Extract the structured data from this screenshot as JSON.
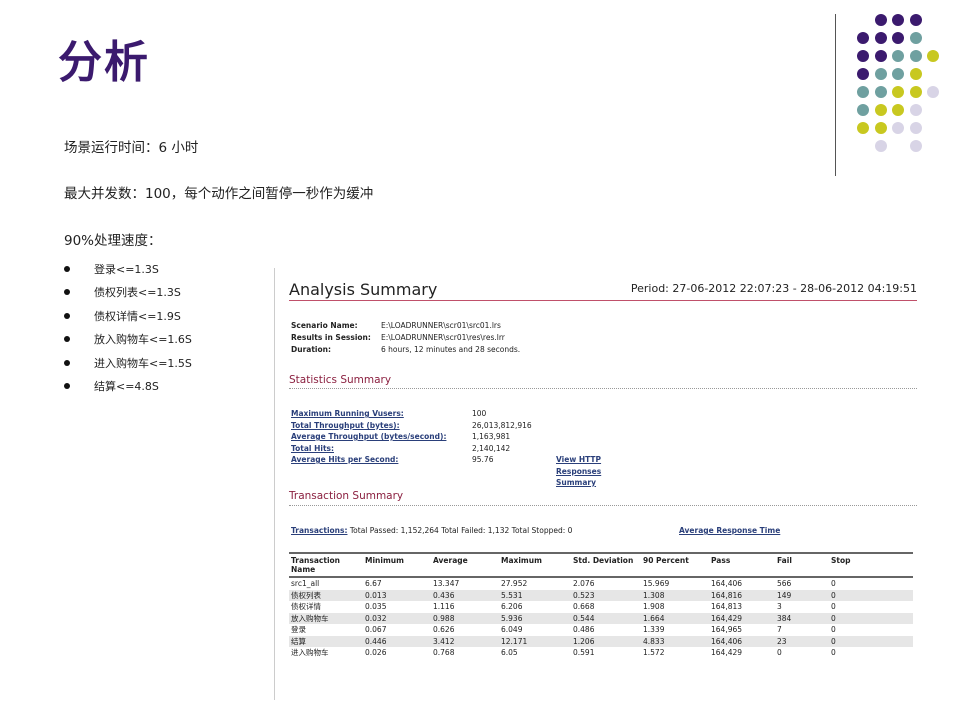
{
  "slide": {
    "title": "分析",
    "line1": "场景运行时间：6 小时",
    "line2": "最大并发数：100，每个动作之间暂停一秒作为缓冲",
    "line3": "90%处理速度：",
    "bullets": [
      "登录<=1.3S",
      "债权列表<=1.3S",
      "债权详情<=1.9S",
      "放入购物车<=1.6S",
      "进入购物车<=1.5S",
      "结算<=4.8S"
    ]
  },
  "decor": {
    "colors": {
      "purple": "#3b1a6e",
      "teal": "#6fa0a0",
      "lime": "#c8c820",
      "lavender": "#d8d4e6"
    }
  },
  "report": {
    "title": "Analysis Summary",
    "period": "Period: 27-06-2012 22:07:23 - 28-06-2012 04:19:51",
    "scenario": [
      {
        "key": "Scenario Name:",
        "value": "E:\\LOADRUNNER\\scr01\\src01.lrs"
      },
      {
        "key": "Results in Session:",
        "value": "E:\\LOADRUNNER\\scr01\\res\\res.lrr"
      },
      {
        "key": "Duration:",
        "value": "6 hours, 12 minutes and 28 seconds."
      }
    ],
    "stats_title": "Statistics Summary",
    "stats": [
      {
        "label": "Maximum Running Vusers:",
        "value": "100"
      },
      {
        "label": "Total Throughput (bytes):",
        "value": "26,013,812,916"
      },
      {
        "label": "Average Throughput (bytes/second):",
        "value": "1,163,981"
      },
      {
        "label": "Total Hits:",
        "value": "2,140,142"
      },
      {
        "label": "Average Hits per Second:",
        "value": "95.76"
      }
    ],
    "http_link": "View HTTP Responses Summary",
    "trans_title": "Transaction Summary",
    "trans_link": "Transactions:",
    "trans_text": " Total Passed: 1,152,264 Total Failed: 1,132 Total Stopped: 0",
    "avg_link": "Average Response Time",
    "columns": [
      "Transaction Name",
      "Minimum",
      "Average",
      "Maximum",
      "Std. Deviation",
      "90 Percent",
      "Pass",
      "Fail",
      "Stop"
    ],
    "rows": [
      [
        "src1_all",
        "6.67",
        "13.347",
        "27.952",
        "2.076",
        "15.969",
        "164,406",
        "566",
        "0"
      ],
      [
        "债权列表",
        "0.013",
        "0.436",
        "5.531",
        "0.523",
        "1.308",
        "164,816",
        "149",
        "0"
      ],
      [
        "债权详情",
        "0.035",
        "1.116",
        "6.206",
        "0.668",
        "1.908",
        "164,813",
        "3",
        "0"
      ],
      [
        "放入购物车",
        "0.032",
        "0.988",
        "5.936",
        "0.544",
        "1.664",
        "164,429",
        "384",
        "0"
      ],
      [
        "登录",
        "0.067",
        "0.626",
        "6.049",
        "0.486",
        "1.339",
        "164,965",
        "7",
        "0"
      ],
      [
        "结算",
        "0.446",
        "3.412",
        "12.171",
        "1.206",
        "4.833",
        "164,406",
        "23",
        "0"
      ],
      [
        "进入购物车",
        "0.026",
        "0.768",
        "6.05",
        "0.591",
        "1.572",
        "164,429",
        "0",
        "0"
      ]
    ]
  }
}
